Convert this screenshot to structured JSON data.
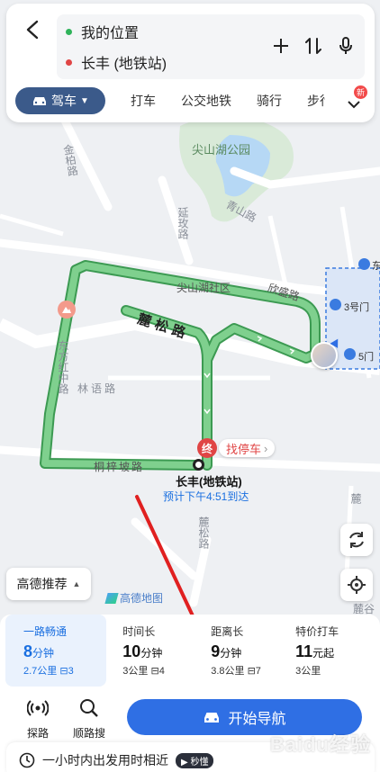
{
  "colors": {
    "accent": "#2f6fe4",
    "route": "#5bbf6e",
    "route_border": "#3c9a52",
    "start_dot": "#2fb35a",
    "end_dot": "#e04545",
    "drive_tab": "#3b5a8a",
    "arrow": "#e02020"
  },
  "header": {
    "start": "我的位置",
    "end": "长丰 (地铁站)"
  },
  "modes": {
    "drive": "驾车",
    "tabs": [
      "打车",
      "公交地铁",
      "骑行",
      "步行"
    ],
    "badge": "新"
  },
  "map_labels": {
    "park": "尖山湖公园",
    "road_qingshan": "青山路",
    "road_jinbai": "金柏路",
    "road_yanyu": "延玫路",
    "community": "尖山湖社区",
    "road_xinsheng": "欣盛路",
    "road_lusong": "麓松路",
    "road_dongfanghong": "东方红中路",
    "road_linyu": "林语路",
    "road_tongzi": "桐梓坡路",
    "road_lusong2": "麓松路",
    "gate3": "3号门",
    "gate5": "5门",
    "end_pin": "终",
    "find_parking": "找停车",
    "dest_name": "长丰(地铁站)",
    "eta": "预计下午4:51到达",
    "corner_left": "麓谷",
    "corner_right": "麓",
    "edge_label": "东"
  },
  "controls": {
    "preference": "高德推荐",
    "logo": "高德地图"
  },
  "plans": [
    {
      "label": "一路畅通",
      "time": "8",
      "unit": "分钟",
      "distance": "2.7公里",
      "lights": "3",
      "active": true
    },
    {
      "label": "时间长",
      "time": "10",
      "unit": "分钟",
      "distance": "3公里",
      "lights": "4",
      "active": false
    },
    {
      "label": "距离长",
      "time": "9",
      "unit": "分钟",
      "distance": "3.8公里",
      "lights": "7",
      "active": false
    },
    {
      "label": "特价打车",
      "time": "11",
      "unit": "元起",
      "distance": "3公里",
      "lights": "",
      "active": false
    }
  ],
  "tools": {
    "explore": "探路",
    "along": "顺路搜"
  },
  "start_nav": "开始导航",
  "hint": {
    "text": "一小时内出发用时相近",
    "tag": "秒懂"
  },
  "watermark": "Baidu经验"
}
